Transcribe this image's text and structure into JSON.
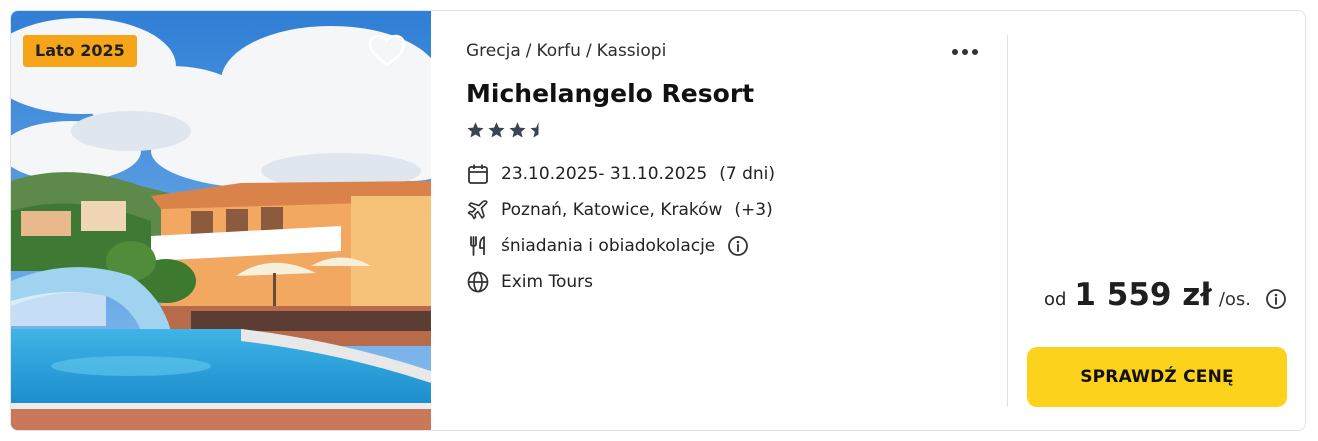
{
  "badge": {
    "label": "Lato 2025",
    "color": "#f6a51a"
  },
  "favorite": {
    "icon": "heart-icon"
  },
  "more": {
    "icon": "more-horizontal-icon"
  },
  "breadcrumb": [
    "Grecja",
    "Korfu",
    "Kassiopi"
  ],
  "breadcrumb_separator": "/",
  "hotel": {
    "name": "Michelangelo Resort",
    "rating": 3.5,
    "rating_max": 4
  },
  "facts": {
    "dates": {
      "icon": "calendar-icon",
      "text": "23.10.2025- 31.10.2025",
      "extra": "(7 dni)"
    },
    "departure": {
      "icon": "plane-icon",
      "text": "Poznań, Katowice, Kraków",
      "extra": "(+3)"
    },
    "board": {
      "icon": "cutlery-icon",
      "text": "śniadania i obiadokolacje",
      "info_icon": "info-icon"
    },
    "operator": {
      "icon": "globe-icon",
      "text": "Exim Tours"
    }
  },
  "price": {
    "prefix": "od",
    "value": "1 559 zł",
    "suffix": "/os.",
    "info_icon": "info-icon"
  },
  "cta": {
    "label": "SPRAWDŹ CENĘ",
    "color": "#fcd21d"
  }
}
